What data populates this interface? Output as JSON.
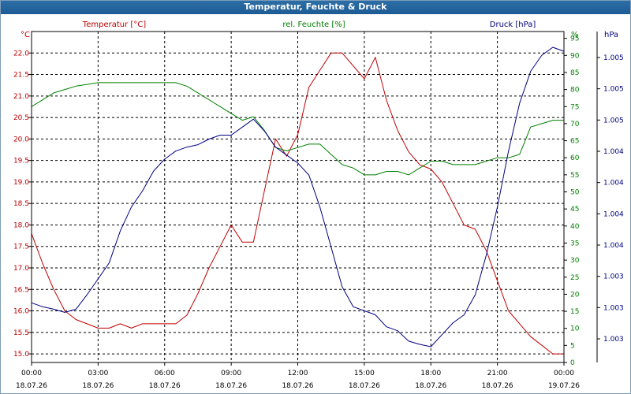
{
  "window": {
    "title": "Temperatur, Feuchte & Druck"
  },
  "chart_data": {
    "type": "line",
    "title": "Temperatur, Feuchte & Druck",
    "grid": true,
    "x_time_labels": [
      "00:00",
      "03:00",
      "06:00",
      "09:00",
      "12:00",
      "15:00",
      "18:00",
      "21:00",
      "00:00"
    ],
    "x_date_labels": [
      "18.07.26",
      "18.07.26",
      "18.07.26",
      "18.07.26",
      "18.07.26",
      "18.07.26",
      "18.07.26",
      "18.07.26",
      "19.07.26"
    ],
    "axes": {
      "left": {
        "unit": "°C",
        "ylim": [
          14.8,
          22.5
        ],
        "ticks": [
          "22.0",
          "21.5",
          "21.0",
          "20.5",
          "20.0",
          "19.5",
          "19.0",
          "18.5",
          "18.0",
          "17.5",
          "17.0",
          "16.5",
          "16.0",
          "15.5",
          "15.0"
        ],
        "color": "#c00000"
      },
      "right1": {
        "unit": "%",
        "ylim": [
          0,
          97
        ],
        "ticks": [
          "95",
          "90",
          "85",
          "80",
          "75",
          "70",
          "65",
          "60",
          "55",
          "50",
          "45",
          "40",
          "35",
          "30",
          "25",
          "20",
          "15",
          "10",
          "5",
          "0"
        ],
        "color": "#008000"
      },
      "right2": {
        "unit": "hPa",
        "ticks": [
          "1.005",
          "1.005",
          "1.005",
          "1.004",
          "1.004",
          "1.004",
          "1.004",
          "1.003",
          "1.003",
          "1.003"
        ],
        "color": "#000080"
      }
    },
    "series": [
      {
        "name": "Temperatur [°C]",
        "axis": "left",
        "color": "#c00000",
        "x": [
          0,
          0.5,
          1,
          1.5,
          2,
          2.5,
          3,
          3.5,
          4,
          4.5,
          5,
          5.5,
          6,
          6.5,
          7,
          7.5,
          8,
          8.5,
          9,
          9.5,
          10,
          10.5,
          11,
          11.5,
          12,
          12.5,
          13,
          13.5,
          14,
          14.5,
          15,
          15.5,
          16,
          16.5,
          17,
          17.5,
          18,
          18.5,
          19,
          19.5,
          20,
          20.5,
          21,
          21.5,
          22,
          22.5,
          23,
          23.5,
          24
        ],
        "y": [
          17.8,
          17.1,
          16.5,
          16.0,
          15.8,
          15.7,
          15.6,
          15.6,
          15.7,
          15.6,
          15.7,
          15.7,
          15.7,
          15.7,
          15.9,
          16.4,
          17.0,
          17.5,
          18.0,
          17.6,
          17.6,
          18.8,
          20.0,
          19.6,
          20.1,
          21.2,
          21.6,
          22.0,
          22.0,
          21.7,
          21.4,
          21.9,
          20.9,
          20.2,
          19.7,
          19.4,
          19.3,
          19.0,
          18.5,
          18.0,
          17.9,
          17.4,
          16.7,
          16.0,
          15.7,
          15.4,
          15.2,
          15.0,
          15.0
        ]
      },
      {
        "name": "rel. Feuchte [%]",
        "axis": "right1",
        "color": "#008000",
        "x": [
          0,
          0.5,
          1,
          1.5,
          2,
          2.5,
          3,
          3.5,
          4,
          4.5,
          5,
          5.5,
          6,
          6.5,
          7,
          7.5,
          8,
          8.5,
          9,
          9.5,
          10,
          10.5,
          11,
          11.5,
          12,
          12.5,
          13,
          13.5,
          14,
          14.5,
          15,
          15.5,
          16,
          16.5,
          17,
          17.5,
          18,
          18.5,
          19,
          19.5,
          20,
          20.5,
          21,
          21.5,
          22,
          22.5,
          23,
          23.5,
          24
        ],
        "y": [
          75,
          77,
          79,
          80,
          81,
          81.5,
          82,
          82,
          82,
          82,
          82,
          82,
          82,
          82,
          81,
          79,
          77,
          75,
          73,
          71,
          72,
          68,
          63,
          62,
          63,
          64,
          64,
          61,
          58,
          57,
          55,
          55,
          56,
          56,
          55,
          57,
          59,
          59,
          58,
          58,
          58,
          59,
          60,
          60,
          61,
          69,
          70,
          71,
          71
        ]
      },
      {
        "name": "Druck [hPa]",
        "axis": "right2",
        "color": "#000080",
        "x": [
          0,
          0.5,
          1,
          1.5,
          2,
          2.5,
          3,
          3.5,
          4,
          4.5,
          5,
          5.5,
          6,
          6.5,
          7,
          7.5,
          8,
          8.5,
          9,
          9.5,
          10,
          10.5,
          11,
          11.5,
          12,
          12.5,
          13,
          13.5,
          14,
          14.5,
          15,
          15.5,
          16,
          16.5,
          17,
          17.5,
          18,
          18.5,
          19,
          19.5,
          20,
          20.5,
          21,
          21.5,
          22,
          22.5,
          23,
          23.5,
          24
        ],
        "y": [
          1.0031,
          1.00305,
          1.00302,
          1.00298,
          1.00302,
          1.0032,
          1.0034,
          1.0036,
          1.004,
          1.0043,
          1.0045,
          1.00475,
          1.0049,
          1.005,
          1.00505,
          1.00508,
          1.00515,
          1.0052,
          1.0052,
          1.0053,
          1.0054,
          1.00525,
          1.00505,
          1.00495,
          1.00485,
          1.0047,
          1.0043,
          1.0038,
          1.0033,
          1.00305,
          1.003,
          1.00295,
          1.0028,
          1.00275,
          1.00262,
          1.00258,
          1.00255,
          1.0027,
          1.00285,
          1.00295,
          1.0032,
          1.0037,
          1.0043,
          1.005,
          1.0056,
          1.006,
          1.0062,
          1.0063,
          1.00625
        ]
      }
    ]
  }
}
